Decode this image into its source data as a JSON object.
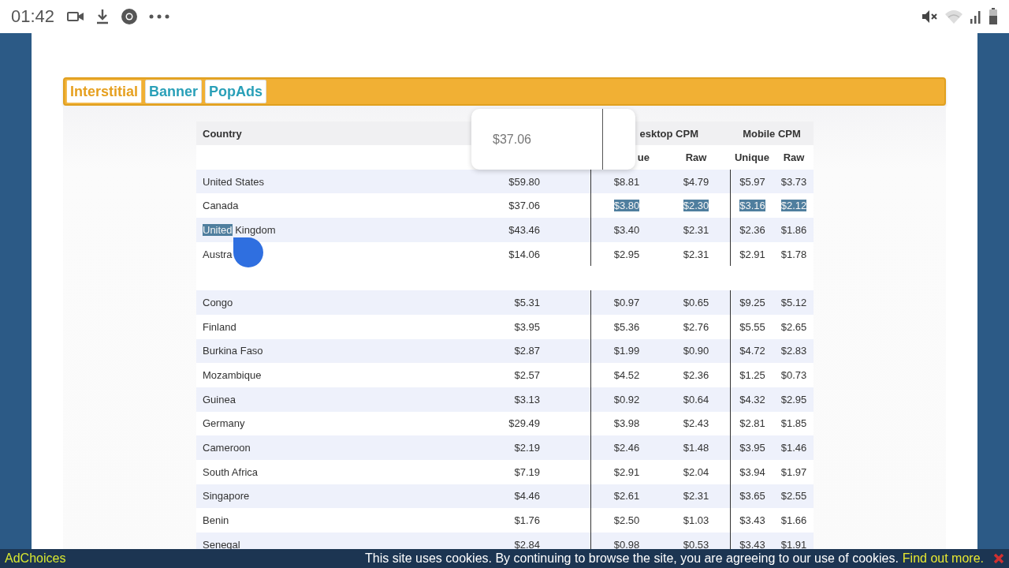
{
  "status_bar": {
    "time": "01:42"
  },
  "tabs": [
    {
      "label": "Interstitial",
      "selected": true
    },
    {
      "label": "Banner",
      "selected": false
    },
    {
      "label": "PopAds",
      "selected": false
    }
  ],
  "table": {
    "header_groups": [
      "Country",
      "esktop CPM",
      "Mobile CPM"
    ],
    "subheaders": [
      "ue",
      "Raw",
      "Unique",
      "Raw"
    ],
    "rows": [
      {
        "kind": "data",
        "country": [
          {
            "text": "United States",
            "selected": false
          }
        ],
        "cells": [
          {
            "text": "$59.80",
            "selected": false
          },
          {
            "text": "$8.81",
            "selected": false
          },
          {
            "text": "$4.79",
            "selected": false
          },
          {
            "text": "$5.97",
            "selected": false
          },
          {
            "text": "$3.73",
            "selected": false
          }
        ]
      },
      {
        "kind": "data",
        "country": [
          {
            "text": "Canada",
            "selected": false
          }
        ],
        "cells": [
          {
            "text": "$37.06",
            "selected": false
          },
          {
            "text": "$3.80",
            "selected": true
          },
          {
            "text": "$2.30",
            "selected": true
          },
          {
            "text": "$3.16",
            "selected": true
          },
          {
            "text": "$2.12",
            "selected": true
          }
        ]
      },
      {
        "kind": "data",
        "country": [
          {
            "text": "United",
            "selected": true
          },
          {
            "text": " Kingdom",
            "selected": false
          }
        ],
        "cells": [
          {
            "text": "$43.46",
            "selected": false
          },
          {
            "text": "$3.40",
            "selected": false
          },
          {
            "text": "$2.31",
            "selected": false
          },
          {
            "text": "$2.36",
            "selected": false
          },
          {
            "text": "$1.86",
            "selected": false
          }
        ]
      },
      {
        "kind": "data",
        "country": [
          {
            "text": "Austra",
            "selected": false
          }
        ],
        "cells": [
          {
            "text": "$14.06",
            "selected": false
          },
          {
            "text": "$2.95",
            "selected": false
          },
          {
            "text": "$2.31",
            "selected": false
          },
          {
            "text": "$2.91",
            "selected": false
          },
          {
            "text": "$1.78",
            "selected": false
          }
        ]
      },
      {
        "kind": "spacer"
      },
      {
        "kind": "data",
        "country": [
          {
            "text": "Congo",
            "selected": false
          }
        ],
        "cells": [
          {
            "text": "$5.31",
            "selected": false
          },
          {
            "text": "$0.97",
            "selected": false
          },
          {
            "text": "$0.65",
            "selected": false
          },
          {
            "text": "$9.25",
            "selected": false
          },
          {
            "text": "$5.12",
            "selected": false
          }
        ]
      },
      {
        "kind": "data",
        "country": [
          {
            "text": "Finland",
            "selected": false
          }
        ],
        "cells": [
          {
            "text": "$3.95",
            "selected": false
          },
          {
            "text": "$5.36",
            "selected": false
          },
          {
            "text": "$2.76",
            "selected": false
          },
          {
            "text": "$5.55",
            "selected": false
          },
          {
            "text": "$2.65",
            "selected": false
          }
        ]
      },
      {
        "kind": "data",
        "country": [
          {
            "text": "Burkina Faso",
            "selected": false
          }
        ],
        "cells": [
          {
            "text": "$2.87",
            "selected": false
          },
          {
            "text": "$1.99",
            "selected": false
          },
          {
            "text": "$0.90",
            "selected": false
          },
          {
            "text": "$4.72",
            "selected": false
          },
          {
            "text": "$2.83",
            "selected": false
          }
        ]
      },
      {
        "kind": "data",
        "country": [
          {
            "text": "Mozambique",
            "selected": false
          }
        ],
        "cells": [
          {
            "text": "$2.57",
            "selected": false
          },
          {
            "text": "$4.52",
            "selected": false
          },
          {
            "text": "$2.36",
            "selected": false
          },
          {
            "text": "$1.25",
            "selected": false
          },
          {
            "text": "$0.73",
            "selected": false
          }
        ]
      },
      {
        "kind": "data",
        "country": [
          {
            "text": "Guinea",
            "selected": false
          }
        ],
        "cells": [
          {
            "text": "$3.13",
            "selected": false
          },
          {
            "text": "$0.92",
            "selected": false
          },
          {
            "text": "$0.64",
            "selected": false
          },
          {
            "text": "$4.32",
            "selected": false
          },
          {
            "text": "$2.95",
            "selected": false
          }
        ]
      },
      {
        "kind": "data",
        "country": [
          {
            "text": "Germany",
            "selected": false
          }
        ],
        "cells": [
          {
            "text": "$29.49",
            "selected": false
          },
          {
            "text": "$3.98",
            "selected": false
          },
          {
            "text": "$2.43",
            "selected": false
          },
          {
            "text": "$2.81",
            "selected": false
          },
          {
            "text": "$1.85",
            "selected": false
          }
        ]
      },
      {
        "kind": "data",
        "country": [
          {
            "text": "Cameroon",
            "selected": false
          }
        ],
        "cells": [
          {
            "text": "$2.19",
            "selected": false
          },
          {
            "text": "$2.46",
            "selected": false
          },
          {
            "text": "$1.48",
            "selected": false
          },
          {
            "text": "$3.95",
            "selected": false
          },
          {
            "text": "$1.46",
            "selected": false
          }
        ]
      },
      {
        "kind": "data",
        "country": [
          {
            "text": "South Africa",
            "selected": false
          }
        ],
        "cells": [
          {
            "text": "$7.19",
            "selected": false
          },
          {
            "text": "$2.91",
            "selected": false
          },
          {
            "text": "$2.04",
            "selected": false
          },
          {
            "text": "$3.94",
            "selected": false
          },
          {
            "text": "$1.97",
            "selected": false
          }
        ]
      },
      {
        "kind": "data",
        "country": [
          {
            "text": "Singapore",
            "selected": false
          }
        ],
        "cells": [
          {
            "text": "$4.46",
            "selected": false
          },
          {
            "text": "$2.61",
            "selected": false
          },
          {
            "text": "$2.31",
            "selected": false
          },
          {
            "text": "$3.65",
            "selected": false
          },
          {
            "text": "$2.55",
            "selected": false
          }
        ]
      },
      {
        "kind": "data",
        "country": [
          {
            "text": "Benin",
            "selected": false
          }
        ],
        "cells": [
          {
            "text": "$1.76",
            "selected": false
          },
          {
            "text": "$2.50",
            "selected": false
          },
          {
            "text": "$1.03",
            "selected": false
          },
          {
            "text": "$3.43",
            "selected": false
          },
          {
            "text": "$1.66",
            "selected": false
          }
        ]
      },
      {
        "kind": "data",
        "country": [
          {
            "text": "Senegal",
            "selected": false
          }
        ],
        "cells": [
          {
            "text": "$2.84",
            "selected": false
          },
          {
            "text": "$0.98",
            "selected": false
          },
          {
            "text": "$0.53",
            "selected": false
          },
          {
            "text": "$3.43",
            "selected": false
          },
          {
            "text": "$1.91",
            "selected": false
          }
        ]
      }
    ]
  },
  "magnifier": {
    "text": "$37.06"
  },
  "cookie_bar": {
    "adchoices": "AdChoices",
    "message": "This site uses cookies. By continuing to browse the site, you are agreeing to our use of cookies.",
    "link": "Find out more."
  }
}
